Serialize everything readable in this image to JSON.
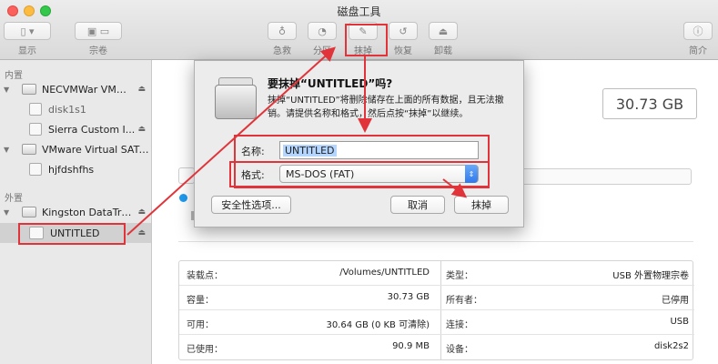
{
  "window": {
    "title": "磁盘工具"
  },
  "toolbar": {
    "display_label": "显示",
    "volume_label": "宗卷",
    "first_aid_label": "急救",
    "partition_label": "分区",
    "erase_label": "抹掉",
    "restore_label": "恢复",
    "unmount_label": "卸载",
    "info_label": "简介",
    "display_icon": "sidebar-toggle-icon",
    "first_aid_icon": "stethoscope-icon",
    "partition_icon": "pie-icon",
    "erase_icon": "eraser-icon",
    "restore_icon": "restore-icon",
    "unmount_icon": "eject-icon",
    "info_icon": "info-icon"
  },
  "sidebar": {
    "internal_header": "内置",
    "external_header": "外置",
    "items": [
      {
        "label": "NECVMWar VMw...",
        "level": "disk"
      },
      {
        "label": "disk1s1",
        "level": "volume"
      },
      {
        "label": "Sierra Custom I...",
        "level": "volume"
      },
      {
        "label": "VMware Virtual SATA...",
        "level": "disk"
      },
      {
        "label": "hjfdshfhs",
        "level": "volume"
      },
      {
        "label": "Kingston DataTra...",
        "level": "disk"
      },
      {
        "label": "UNTITLED",
        "level": "volume"
      }
    ]
  },
  "main": {
    "size": "30.73 GB",
    "info": {
      "left": [
        {
          "key": "装载点：",
          "value": "/Volumes/UNTITLED"
        },
        {
          "key": "容量：",
          "value": "30.73 GB"
        },
        {
          "key": "可用：",
          "value": "30.64 GB (0 KB 可清除)"
        },
        {
          "key": "已使用：",
          "value": "90.9 MB"
        }
      ],
      "right": [
        {
          "key": "类型：",
          "value": "USB 外置物理宗卷"
        },
        {
          "key": "所有者：",
          "value": "已停用"
        },
        {
          "key": "连接：",
          "value": "USB"
        },
        {
          "key": "设备：",
          "value": "disk2s2"
        }
      ]
    }
  },
  "dialog": {
    "title": "要抹掉“UNTITLED”吗?",
    "description": "抹掉“UNTITLED”将删除储存在上面的所有数据，且无法撤销。请提供名称和格式，然后点按“抹掉”以继续。",
    "name_label": "名称:",
    "name_value": "UNTITLED",
    "format_label": "格式:",
    "format_value": "MS-DOS (FAT)",
    "security_button": "安全性选项...",
    "cancel_button": "取消",
    "erase_button": "抹掉"
  },
  "annotation_color": "#e0343a"
}
